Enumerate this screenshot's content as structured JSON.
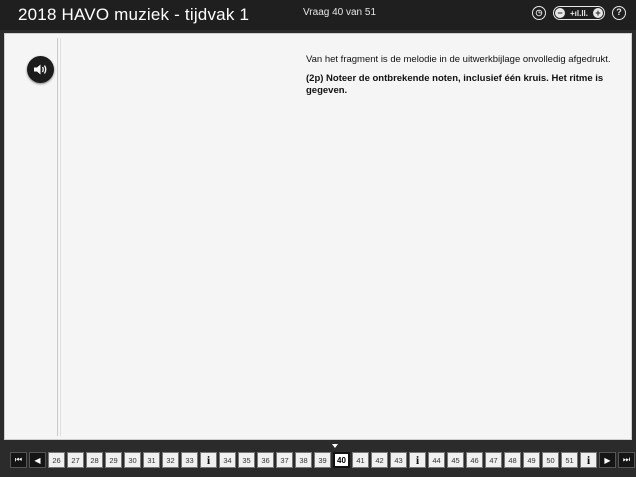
{
  "header": {
    "title": "2018 HAVO muziek - tijdvak 1",
    "question_counter": "Vraag 40 van 51",
    "zoom_minus": "−",
    "zoom_level": "+ıl.ll.",
    "zoom_plus": "+",
    "help": "?"
  },
  "question": {
    "intro": "Van het fragment is de melodie in de uitwerkbijlage onvolledig afgedrukt.",
    "instruction": "(2p) Noteer de ontbrekende noten, inclusief één kruis. Het ritme is gegeven."
  },
  "nav": {
    "first": "⏮",
    "prev": "◀",
    "next": "▶",
    "last": "⏭",
    "items": [
      {
        "label": "26",
        "type": "q"
      },
      {
        "label": "27",
        "type": "q"
      },
      {
        "label": "28",
        "type": "q"
      },
      {
        "label": "29",
        "type": "q"
      },
      {
        "label": "30",
        "type": "q"
      },
      {
        "label": "31",
        "type": "q"
      },
      {
        "label": "32",
        "type": "q"
      },
      {
        "label": "33",
        "type": "q"
      },
      {
        "label": "i",
        "type": "info"
      },
      {
        "label": "34",
        "type": "q"
      },
      {
        "label": "35",
        "type": "q"
      },
      {
        "label": "36",
        "type": "q"
      },
      {
        "label": "37",
        "type": "q"
      },
      {
        "label": "38",
        "type": "q"
      },
      {
        "label": "39",
        "type": "q"
      },
      {
        "label": "40",
        "type": "current"
      },
      {
        "label": "41",
        "type": "q"
      },
      {
        "label": "42",
        "type": "q"
      },
      {
        "label": "43",
        "type": "q"
      },
      {
        "label": "i",
        "type": "info"
      },
      {
        "label": "44",
        "type": "q"
      },
      {
        "label": "45",
        "type": "q"
      },
      {
        "label": "46",
        "type": "q"
      },
      {
        "label": "47",
        "type": "q"
      },
      {
        "label": "48",
        "type": "q"
      },
      {
        "label": "49",
        "type": "q"
      },
      {
        "label": "50",
        "type": "q"
      },
      {
        "label": "51",
        "type": "q"
      },
      {
        "label": "i",
        "type": "info"
      }
    ]
  }
}
